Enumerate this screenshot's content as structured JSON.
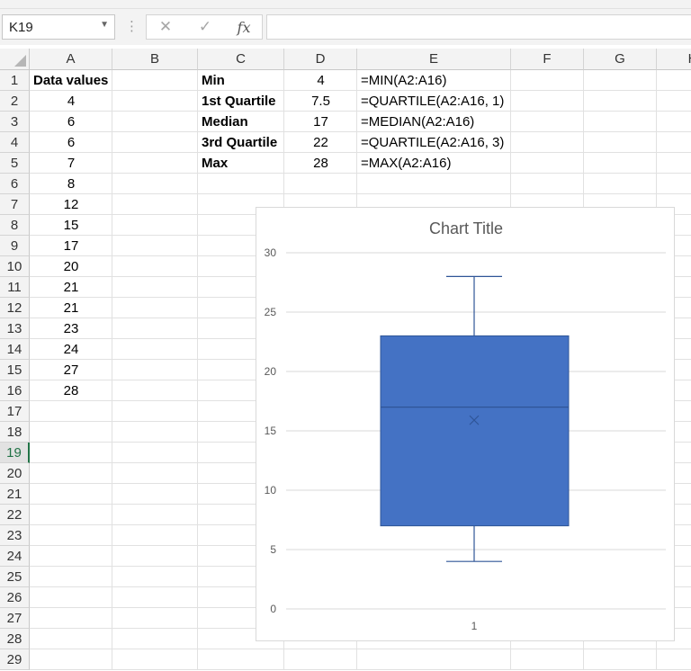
{
  "formula_bar": {
    "name_box": "K19",
    "cancel_icon": "close-icon",
    "enter_icon": "check-icon",
    "function_label": "fx",
    "formula": ""
  },
  "sheet": {
    "columns": [
      "A",
      "B",
      "C",
      "D",
      "E",
      "F",
      "G",
      "H"
    ],
    "rows": [
      "1",
      "2",
      "3",
      "4",
      "5",
      "6",
      "7",
      "8",
      "9",
      "10",
      "11",
      "12",
      "13",
      "14",
      "15",
      "16",
      "17",
      "18",
      "19",
      "20",
      "21",
      "22",
      "23",
      "24",
      "25",
      "26",
      "27",
      "28",
      "29"
    ],
    "active_row": "19",
    "column_a": {
      "header": "Data values",
      "values": [
        "4",
        "6",
        "6",
        "7",
        "8",
        "12",
        "15",
        "17",
        "20",
        "21",
        "21",
        "23",
        "24",
        "27",
        "28"
      ]
    },
    "stats": [
      {
        "label": "Min",
        "value": "4",
        "formula": "=MIN(A2:A16)"
      },
      {
        "label": "1st Quartile",
        "value": "7.5",
        "formula": "=QUARTILE(A2:A16, 1)"
      },
      {
        "label": "Median",
        "value": "17",
        "formula": "=MEDIAN(A2:A16)"
      },
      {
        "label": "3rd Quartile",
        "value": "22",
        "formula": "=QUARTILE(A2:A16, 3)"
      },
      {
        "label": "Max",
        "value": "28",
        "formula": "=MAX(A2:A16)"
      }
    ]
  },
  "chart_data": {
    "type": "box",
    "title": "Chart Title",
    "categories": [
      "1"
    ],
    "ylim": [
      0,
      30
    ],
    "yticks": [
      "0",
      "5",
      "10",
      "15",
      "20",
      "25",
      "30"
    ],
    "grid": true,
    "series": [
      {
        "whisker_low": 4,
        "q1": 7,
        "median": 17,
        "q3": 23,
        "whisker_high": 28,
        "mean": 15.9
      }
    ],
    "colors": {
      "box_fill": "#4472c4",
      "box_line": "#2f5597",
      "grid": "#d9d9d9",
      "text": "#595959"
    }
  }
}
